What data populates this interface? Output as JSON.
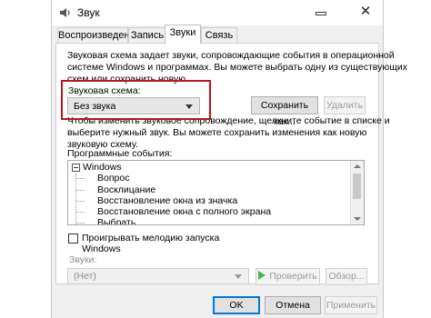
{
  "window": {
    "title": "Звук"
  },
  "tabs": [
    {
      "label": "Воспроизведение",
      "active": false
    },
    {
      "label": "Запись",
      "active": false
    },
    {
      "label": "Звуки",
      "active": true
    },
    {
      "label": "Связь",
      "active": false
    }
  ],
  "sounds_tab": {
    "intro_line1": "Звуковая схема задает звуки, сопровождающие события в операционной",
    "intro_line2": "системе Windows и программах. Вы можете выбрать одну из существующих",
    "intro_line3": "схем или сохранить новую.",
    "scheme_label": "Звуковая схема:",
    "scheme_value": "Без звука",
    "save_as_button": "Сохранить как...",
    "delete_button": "Удалить",
    "instructions_line1": "Чтобы изменить звуковое сопровождение, щелкните событие в списке и",
    "instructions_line2": "выберите нужный звук. Вы можете сохранить изменения как новую",
    "instructions_line3": "звуковую схему.",
    "events_label": "Программные события:",
    "events": [
      "Windows",
      "Вопрос",
      "Восклицание",
      "Восстановление окна из значка",
      "Восстановление окна с полного экрана",
      "Выбрать"
    ],
    "startup_checkbox_label": "Проигрывать мелодию запуска Windows",
    "startup_checked": false,
    "sounds_label": "Звуки:",
    "sound_value": "(Нет)",
    "test_button": "Проверить",
    "browse_button": "Обзор..."
  },
  "footer": {
    "ok_button": "OK",
    "cancel_button": "Отмена",
    "apply_button": "Применить"
  },
  "colors": {
    "highlight_box": "#c0141a",
    "default_button_border": "#0078d7",
    "play_icon": "#4fb04f"
  }
}
